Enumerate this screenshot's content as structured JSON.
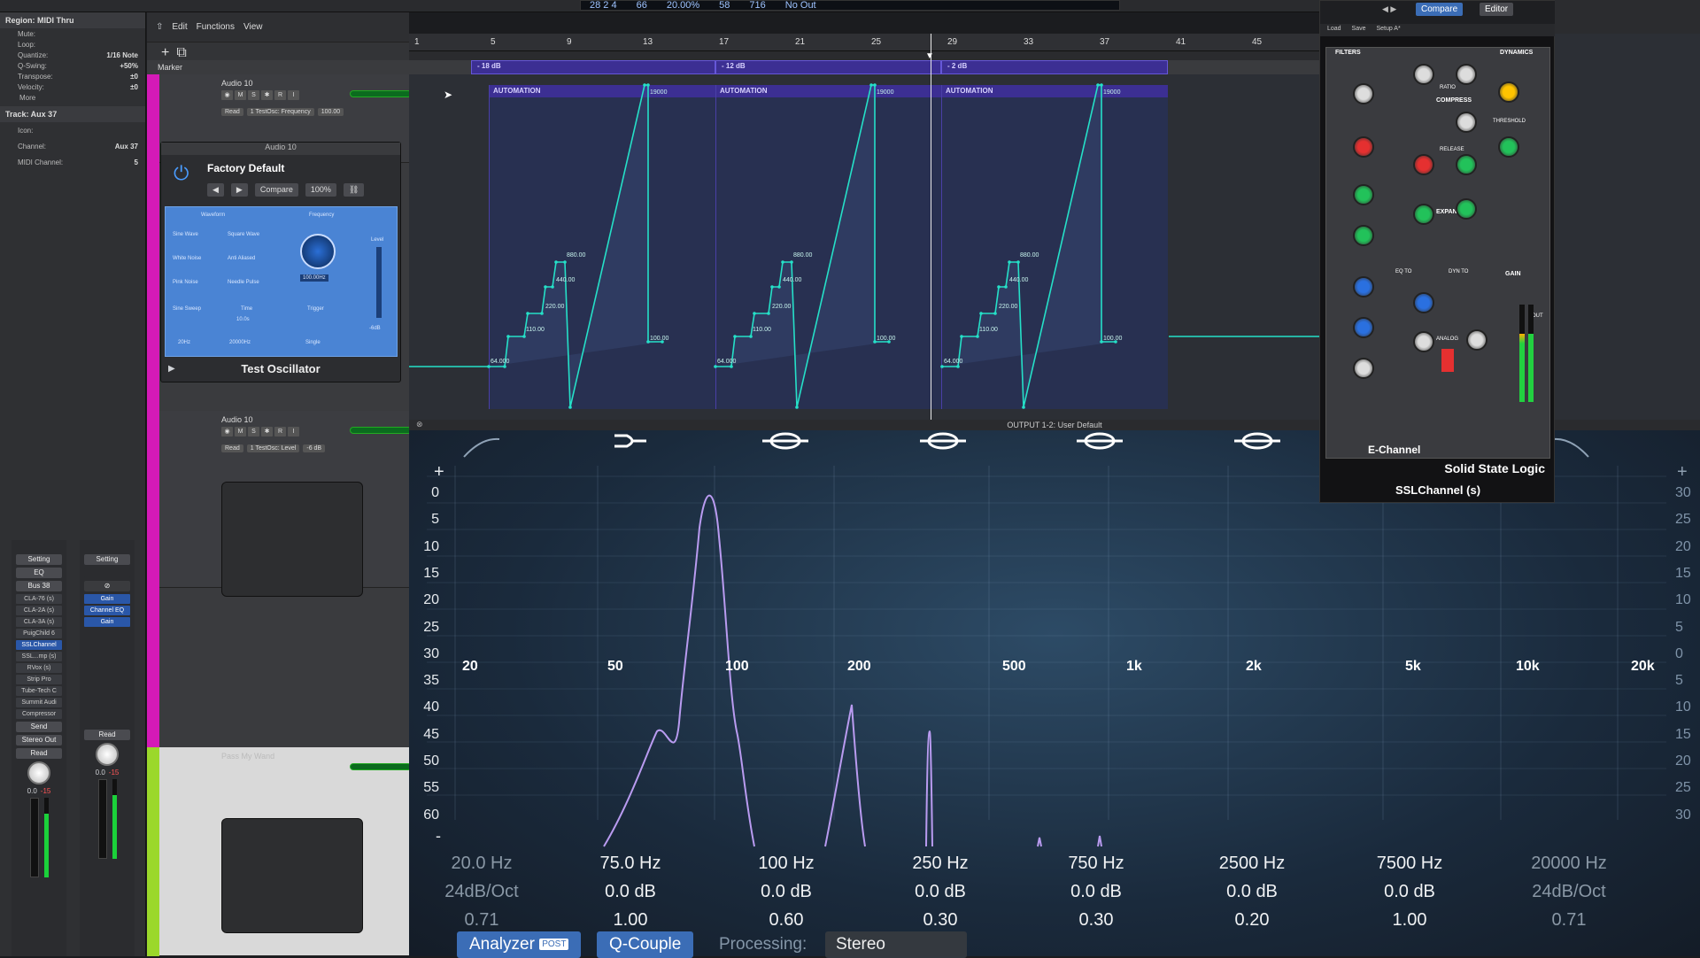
{
  "transport": {
    "bar": "28  2  4",
    "sub": "66",
    "tempo_pct": "20.00%",
    "val1": "58",
    "val2": "716",
    "out": "No Out"
  },
  "inspector": {
    "region_title": "Region: MIDI Thru",
    "rows": [
      {
        "label": "Mute:",
        "value": ""
      },
      {
        "label": "Loop:",
        "value": ""
      },
      {
        "label": "Quantize:",
        "value": "1/16 Note"
      },
      {
        "label": "Q-Swing:",
        "value": "+50%"
      },
      {
        "label": "Transpose:",
        "value": "±0"
      },
      {
        "label": "Velocity:",
        "value": "±0"
      }
    ],
    "more": "More",
    "track_title": "Track: Aux 37",
    "track_rows": [
      {
        "label": "Icon:",
        "value": ""
      },
      {
        "label": "Channel:",
        "value": "Aux 37"
      },
      {
        "label": "MIDI Channel:",
        "value": "5"
      }
    ]
  },
  "strip1": {
    "setting": "Setting",
    "eq": "EQ",
    "bus": "Bus 38",
    "inserts": [
      "CLA-76 (s)",
      "CLA-2A (s)",
      "CLA-3A (s)",
      "PuigChild 6",
      "SSLChannel",
      "SSL...mp (s)",
      "RVox (s)",
      "Strip Pro",
      "Tube-Tech C",
      "Summit Audi",
      "Compressor"
    ],
    "send": "Send",
    "output": "Stereo Out",
    "mode": "Read",
    "vals": [
      "0.0",
      "-15"
    ]
  },
  "strip2": {
    "setting": "Setting",
    "inserts": [
      "Gain",
      "Channel EQ",
      "Gain"
    ],
    "mode": "Read",
    "vals": [
      "0.0",
      "-15"
    ]
  },
  "toolbar": {
    "edit": "Edit",
    "functions": "Functions",
    "view": "View"
  },
  "marker": {
    "label": "Marker"
  },
  "tracks": [
    {
      "name": "Audio 10",
      "read": "Read",
      "param": "1 TestOsc: Frequency",
      "value": "100.00"
    },
    {
      "name": "Audio 10",
      "read": "Read",
      "param": "1 TestOsc: Level",
      "value": "-6 dB"
    },
    {
      "name": "Pass My Wand",
      "read": "",
      "param": "",
      "value": ""
    }
  ],
  "oscillator": {
    "window_title": "Audio 10",
    "preset": "Factory Default",
    "compare": "Compare",
    "zoom": "100%",
    "waveform": "Waveform",
    "sine": "Sine Wave",
    "square": "Square Wave",
    "white": "White Noise",
    "aliased": "Anti Aliased",
    "pink": "Pink Noise",
    "needle": "Needle Pulse",
    "sweep": "Sine Sweep",
    "time": "Time",
    "trigger": "Trigger",
    "freq_label": "Frequency",
    "freq": "100.00Hz",
    "level": "Level",
    "start": "20Hz",
    "end": "20000Hz",
    "single": "Single",
    "sweep_time": "10.0s",
    "level_val": "-6dB",
    "title": "Test Oscillator"
  },
  "ruler": [
    "1",
    "5",
    "9",
    "13",
    "17",
    "21",
    "25",
    "29",
    "33",
    "37",
    "41",
    "45"
  ],
  "regions": [
    {
      "label": "- 18 dB",
      "auto": "AUTOMATION"
    },
    {
      "label": "- 12 dB",
      "auto": "AUTOMATION"
    },
    {
      "label": "- 2 dB",
      "auto": "AUTOMATION"
    }
  ],
  "auto_labels": {
    "top": "19000",
    "top_last": "19000 Hz",
    "mid": "880.00",
    "step1": "440.00",
    "step2": "220.00",
    "step3": "110.00",
    "low": "64.000",
    "low_hz": "64.000 Hz",
    "end": "100.00",
    "end_hz": "100.00 Hz"
  },
  "eq": {
    "output_label": "OUTPUT 1-2: User Default",
    "plus": "+",
    "minus": "-",
    "db_left": [
      "0",
      "5",
      "10",
      "15",
      "20",
      "25",
      "30",
      "35",
      "40",
      "45",
      "50",
      "55",
      "60"
    ],
    "db_right": [
      "30",
      "25",
      "20",
      "15",
      "10",
      "5",
      "0",
      "5",
      "10",
      "15",
      "20",
      "25",
      "30"
    ],
    "freqs": [
      "20",
      "50",
      "100",
      "200",
      "500",
      "1k",
      "2k",
      "5k",
      "10k",
      "20k"
    ],
    "bands": [
      {
        "freq": "20.0 Hz",
        "gain": "24dB/Oct",
        "q": "0.71",
        "dim": true
      },
      {
        "freq": "75.0 Hz",
        "gain": "0.0 dB",
        "q": "1.00",
        "dim": false
      },
      {
        "freq": "100 Hz",
        "gain": "0.0 dB",
        "q": "0.60",
        "dim": false
      },
      {
        "freq": "250 Hz",
        "gain": "0.0 dB",
        "q": "0.30",
        "dim": false
      },
      {
        "freq": "750 Hz",
        "gain": "0.0 dB",
        "q": "0.30",
        "dim": false
      },
      {
        "freq": "2500 Hz",
        "gain": "0.0 dB",
        "q": "0.20",
        "dim": false
      },
      {
        "freq": "7500 Hz",
        "gain": "0.0 dB",
        "q": "1.00",
        "dim": false
      },
      {
        "freq": "20000 Hz",
        "gain": "24dB/Oct",
        "q": "0.71",
        "dim": true
      }
    ],
    "analyzer": "Analyzer",
    "post": "POST",
    "qcouple": "Q-Couple",
    "processing_label": "Processing:",
    "processing_value": "Stereo"
  },
  "ssl": {
    "compare": "Compare",
    "editor": "Editor",
    "setup": "Setup A*",
    "load": "Load",
    "save": "Save",
    "filters": "FILTERS",
    "dynamics": "DYNAMICS",
    "compress": "COMPRESS",
    "expand": "EXPAND",
    "threshold": "THRESHOLD",
    "release": "RELEASE",
    "ratio": "RATIO",
    "gain": "GAIN",
    "eq_to": "EQ TO",
    "dyn_to": "DYN TO",
    "analog": "ANALOG",
    "out": "OUT",
    "echannel": "E-Channel",
    "brand": "Solid State Logic",
    "name": "SSLChannel (s)"
  }
}
